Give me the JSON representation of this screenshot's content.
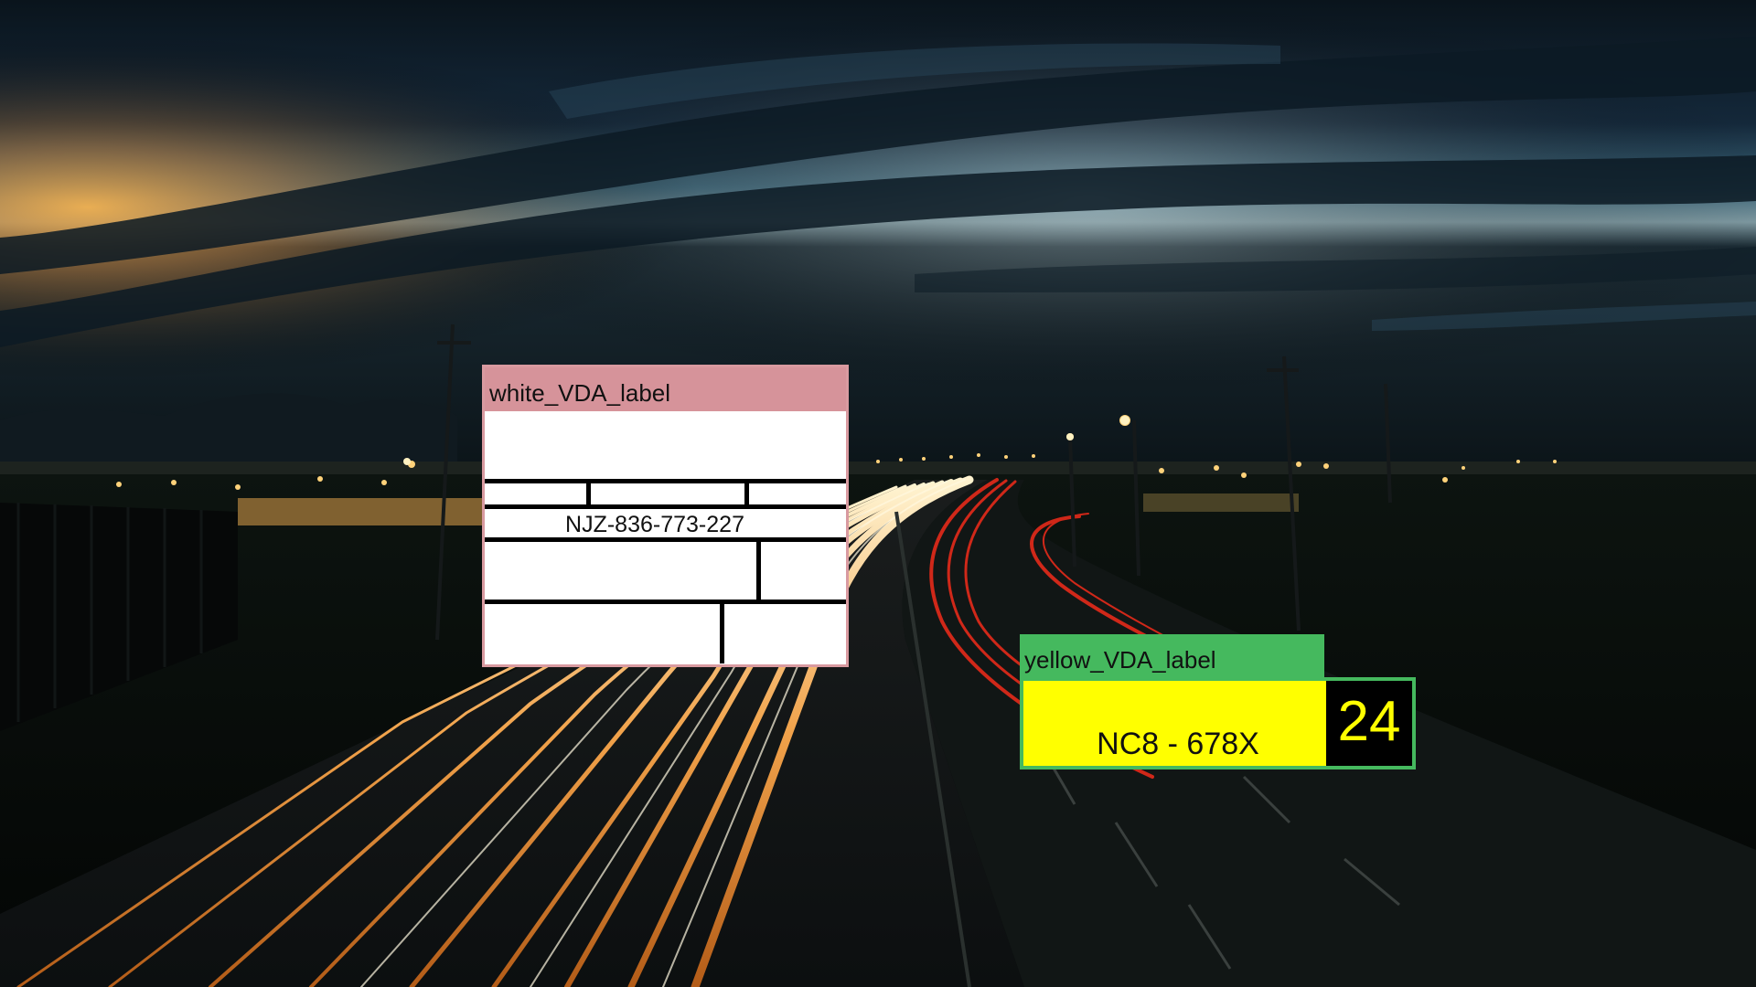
{
  "white_label": {
    "title": "white_VDA_label",
    "code": "NJZ-836-773-227"
  },
  "yellow_label": {
    "title": "yellow_VDA_label",
    "code": "NC8 - 678X",
    "number": "24"
  },
  "colors": {
    "white_label_header": "#d6939a",
    "yellow_label_header": "#45b95e",
    "yellow_label_body": "#ffff00"
  }
}
